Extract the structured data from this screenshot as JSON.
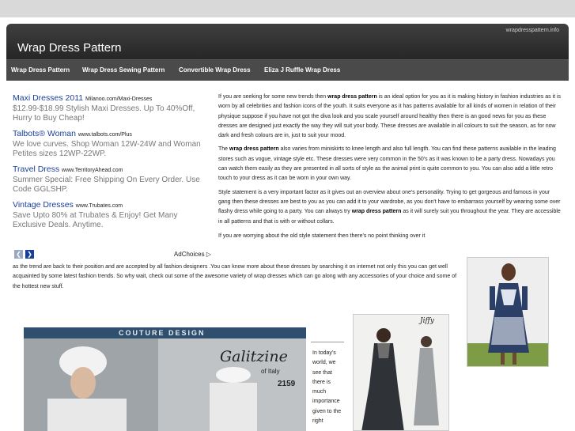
{
  "header": {
    "url": "wrapdresspattern.info",
    "title": "Wrap Dress Pattern"
  },
  "nav": [
    {
      "label": "Wrap Dress Pattern"
    },
    {
      "label": "Wrap Dress Sewing Pattern"
    },
    {
      "label": "Convertible Wrap Dress"
    },
    {
      "label": "Eliza J Ruffle Wrap Dress"
    }
  ],
  "ads": [
    {
      "title": "Maxi Dresses 2011",
      "url": "Milanoo.com/Maxi-Dresses",
      "body": "$12.99-$18.99 Stylish Maxi Dresses. Up To 40%Off, Hurry to Buy Cheap!"
    },
    {
      "title": "Talbots® Woman",
      "url": "www.talbots.com/Plus",
      "body": "We love curves. Shop Woman 12W-24W and Woman Petites sizes 12WP-22WP."
    },
    {
      "title": "Travel Dress",
      "url": "www.TerritoryAhead.com",
      "body": "Summer Special: Free Shipping On Every Order. Use Code GGLSHP."
    },
    {
      "title": "Vintage Dresses",
      "url": "www.Trubates.com",
      "body": "Save Upto 80% at Trubates & Enjoy! Get Many Exclusive Deals. Anytime."
    }
  ],
  "adchoices": "AdChoices",
  "prev_arrow": "❮",
  "next_arrow": "❯",
  "article": {
    "p1_a": "If you are seeking for some new trends then ",
    "p1_b": "wrap dress pattern",
    "p1_c": " is an ideal option for you as it is making history in fashion industries as it is worn by all celebrities and fashion icons of the youth. It suits everyone as it has patterns available for all kinds of women in relation of their physique suppose if you have not got the diva look and you scale yourself  around healthy then there is an good news for you as these dresses are designed just exactly the way they will suit your body. These dresses are available in all colours to suit the season, as for now dark and fresh colours are in, just to suit your mood.",
    "p2_a": "The ",
    "p2_b": "wrap dress pattern",
    "p2_c": " also varies from miniskirts to knee length and also full length. You can find these patterns available in the leading stores such as vogue, vintage style etc.  These dresses were very common in the 50's as it was known to be a party dress. Nowadays you can watch them easily as they are presented in all sorts of style as the animal print is quite common to you. You can also add a little retro touch to your dress as it can be worn in your own way.",
    "p3_a": "Style statement is a very important factor as it gives out an overview about one's personality. Trying to get gorgeous and famous in your gang then these dresses are best to you as you can add it to your wardrobe, as you don't have to embarrass yourself by wearing some over flashy dress while going to a party. You can always try ",
    "p3_b": "wrap dress pattern",
    "p3_c": " as it will surely suit you throughout the year. They are accessible in all patterns and that is with or without collars.",
    "p4_start": "If you are worrying about the old style statement then there's no point thinking over it",
    "p4_rest": "as the trend are back to their position and are accepted by all fashion designers .You can know more about these dresses by searching it on internet not only this you can get well acquainted by some latest fashion trends. So why wait, check out some of the awesome variety of wrap dresses which can go along with any accessories of your choice and some of the hottest new stuff.",
    "caption": "In today's world, we see that there is much importance given to the right"
  },
  "images": {
    "pattern_brand": "Galitzine",
    "pattern_sub": "of Italy",
    "pattern_number": "2159",
    "pattern_banner": "COUTURE DESIGN",
    "right_logo": "Jiffy"
  },
  "colors": {
    "header": "#2e2e2e",
    "nav": "#4a4a4a",
    "ad_title": "#1a3f99",
    "ad_body": "#777777"
  }
}
